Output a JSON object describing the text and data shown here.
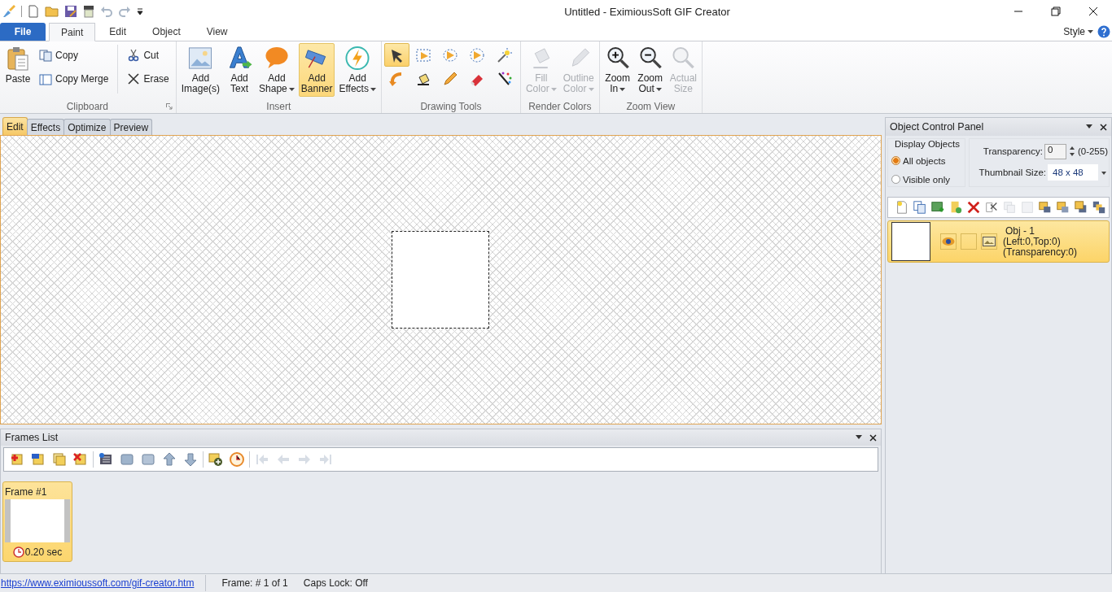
{
  "window": {
    "title": "Untitled - EximiousSoft GIF Creator"
  },
  "file_button": "File",
  "ribbon_tabs": [
    {
      "label": "Paint",
      "selected": true
    },
    {
      "label": "Edit",
      "selected": false
    },
    {
      "label": "Object",
      "selected": false
    },
    {
      "label": "View",
      "selected": false
    }
  ],
  "style_menu": "Style",
  "ribbon_groups": [
    {
      "title": "Clipboard",
      "buttons": [
        {
          "label": "Paste",
          "kind": "large"
        },
        {
          "label": "Copy",
          "kind": "small"
        },
        {
          "label": "Copy Merge",
          "kind": "small"
        },
        {
          "label": "Cut",
          "kind": "small"
        },
        {
          "label": "Erase",
          "kind": "small"
        }
      ]
    },
    {
      "title": "Insert",
      "buttons": [
        {
          "label": "Add Image(s)",
          "kind": "large"
        },
        {
          "label": "Add Text",
          "kind": "large"
        },
        {
          "label": "Add Shape",
          "kind": "large",
          "dropdown": true
        },
        {
          "label": "Add Banner",
          "kind": "large",
          "selected": true
        },
        {
          "label": "Add Effects",
          "kind": "large",
          "dropdown": true
        }
      ]
    },
    {
      "title": "Drawing Tools",
      "buttons": [
        {
          "kind": "tool",
          "selected": true
        },
        {
          "kind": "tool",
          "selected": false
        },
        {
          "kind": "tool",
          "selected": false
        },
        {
          "kind": "tool",
          "selected": false
        },
        {
          "kind": "tool",
          "selected": false
        },
        {
          "kind": "tool",
          "selected": false
        },
        {
          "kind": "tool",
          "selected": false
        },
        {
          "kind": "tool",
          "selected": false
        },
        {
          "kind": "tool",
          "selected": false
        },
        {
          "kind": "tool",
          "selected": false
        }
      ]
    },
    {
      "title": "Render Colors",
      "buttons": [
        {
          "label": "Fill Color",
          "kind": "large",
          "dropdown": true,
          "disabled": true
        },
        {
          "label": "Outline Color",
          "kind": "large",
          "dropdown": true,
          "disabled": true
        }
      ]
    },
    {
      "title": "Zoom View",
      "buttons": [
        {
          "label": "Zoom In",
          "kind": "large",
          "dropdown": true
        },
        {
          "label": "Zoom Out",
          "kind": "large",
          "dropdown": true
        },
        {
          "label": "Actual Size",
          "kind": "large",
          "disabled": true
        }
      ]
    }
  ],
  "document_tabs": [
    {
      "label": "Edit",
      "selected": true
    },
    {
      "label": "Effects",
      "selected": false
    },
    {
      "label": "Optimize",
      "selected": false
    },
    {
      "label": "Preview",
      "selected": false
    }
  ],
  "frames_list": {
    "title": "Frames List",
    "toolbar": [
      {
        "disabled": false
      },
      {
        "disabled": false
      },
      {
        "disabled": false
      },
      {
        "disabled": false
      },
      {
        "disabled": false
      },
      {
        "disabled": false
      },
      {
        "disabled": false
      },
      {
        "disabled": false
      },
      {
        "disabled": false
      },
      {
        "disabled": false
      },
      {
        "disabled": false
      },
      {
        "disabled": true
      },
      {
        "disabled": true
      },
      {
        "disabled": true
      },
      {
        "disabled": true
      }
    ],
    "frames": [
      {
        "label": "Frame #1",
        "duration": "0.20 sec",
        "selected": true
      }
    ]
  },
  "object_panel": {
    "title": "Object Control Panel",
    "display_objects": {
      "title": "Display Objects",
      "options": [
        {
          "label": "All objects",
          "selected": true
        },
        {
          "label": "Visible only",
          "selected": false
        }
      ]
    },
    "transparency": {
      "label": "Transparency:",
      "value": "0",
      "range": "(0-255)"
    },
    "thumbnail_size": {
      "label": "Thumbnail Size:",
      "value": "48 x 48"
    },
    "toolbar": [
      {
        "disabled": false
      },
      {
        "disabled": false
      },
      {
        "disabled": false
      },
      {
        "disabled": false
      },
      {
        "disabled": false
      },
      {
        "disabled": false
      },
      {
        "disabled": true
      },
      {
        "disabled": true
      },
      {
        "disabled": false
      },
      {
        "disabled": false
      },
      {
        "disabled": false
      },
      {
        "disabled": false
      }
    ],
    "objects": [
      {
        "name": "Obj - 1",
        "position": "(Left:0,Top:0)",
        "transparency": "(Transparency:0)",
        "visible": true,
        "selected": true
      }
    ]
  },
  "status_bar": {
    "link": "https://www.eximioussoft.com/gif-creator.htm",
    "frame": "Frame: # 1 of 1",
    "caps_lock": "Caps Lock: Off"
  }
}
